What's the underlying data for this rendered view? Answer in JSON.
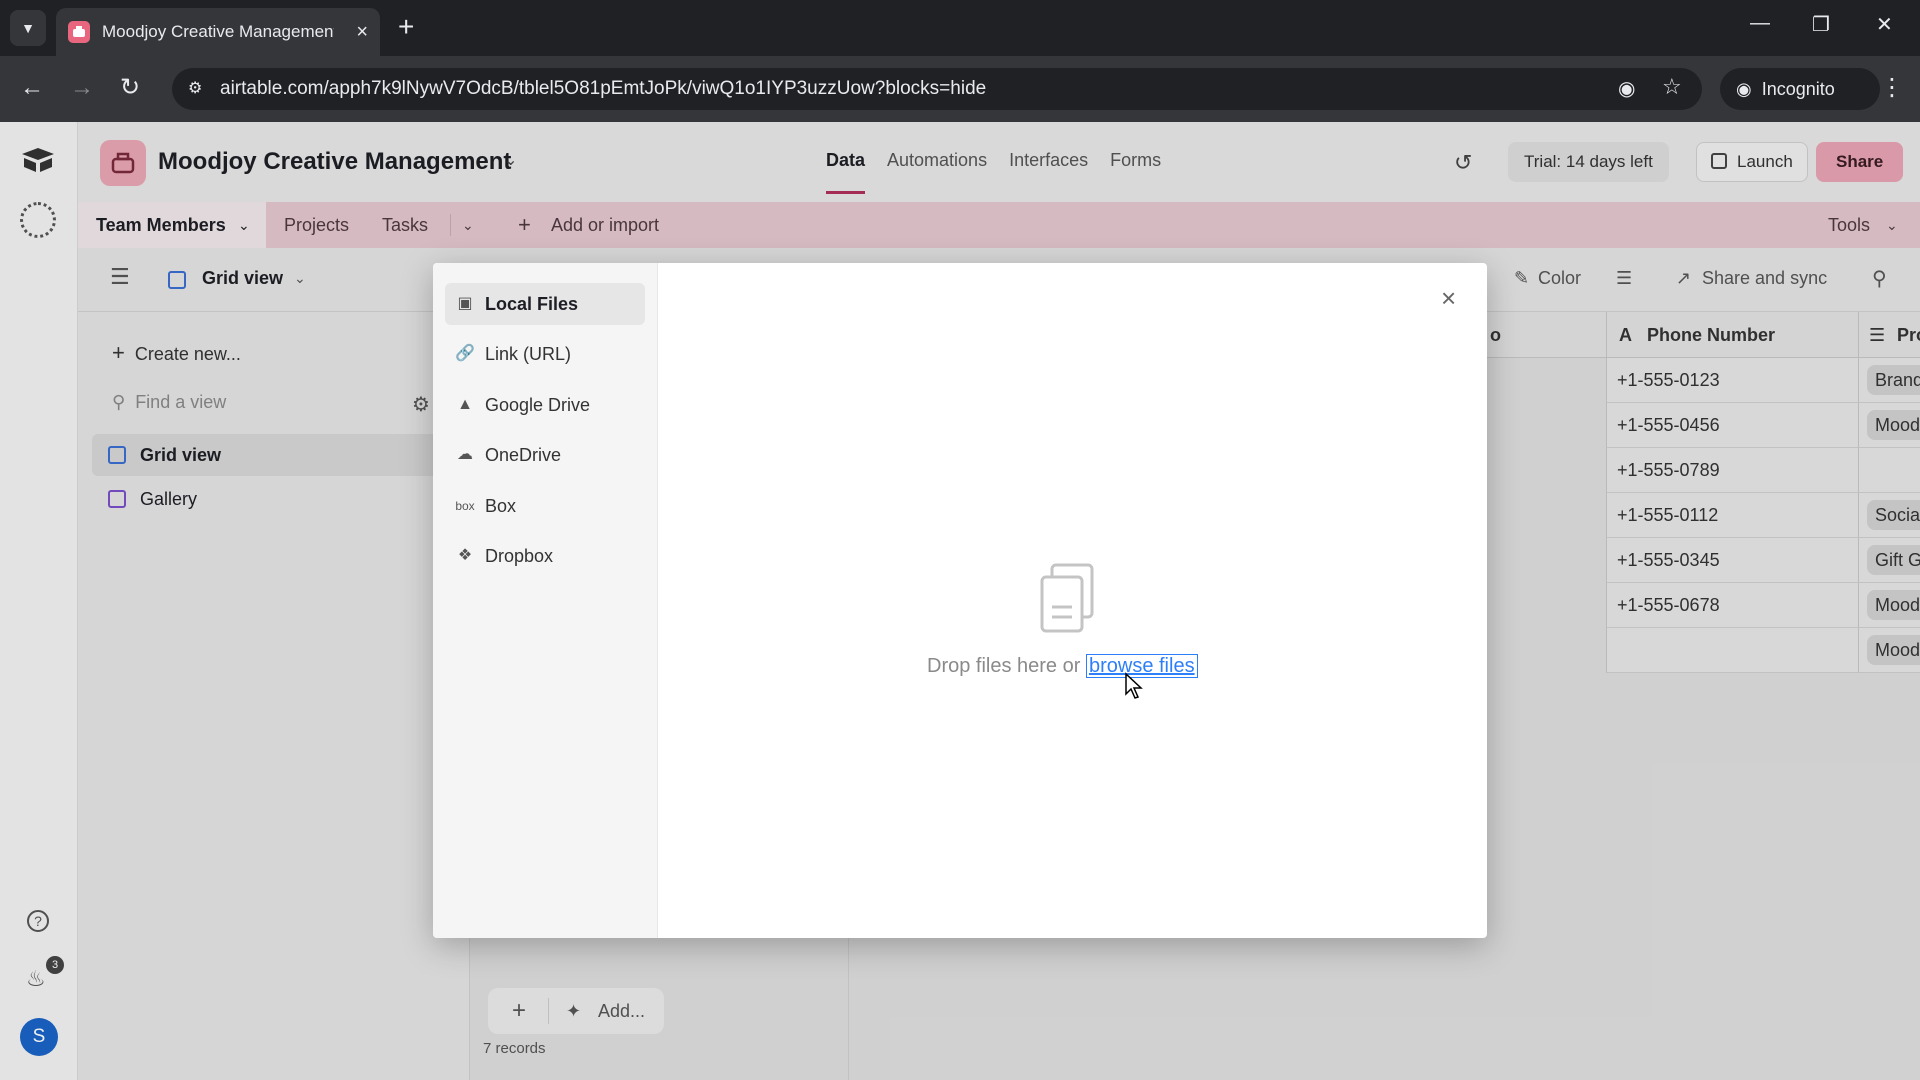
{
  "browser": {
    "tab_title": "Moodjoy Creative Management",
    "url": "airtable.com/apph7k9lNywV7OdcB/tblel5O81pEmtJoPk/viwQ1o1IYP3uzzUow?blocks=hide",
    "incognito_label": "Incognito",
    "brand_color": "#e8677f"
  },
  "header": {
    "base_name": "Moodjoy Creative Management",
    "nav": [
      "Data",
      "Automations",
      "Interfaces",
      "Forms"
    ],
    "trial": "Trial: 14 days left",
    "launch": "Launch",
    "share": "Share",
    "accent": "#b0305b"
  },
  "tables": {
    "active": "Team Members",
    "items": [
      "Projects",
      "Tasks"
    ],
    "add": "Add or import",
    "tools": "Tools"
  },
  "viewbar": {
    "view_name": "Grid view",
    "color": "Color",
    "share_sync": "Share and sync"
  },
  "views": {
    "create": "Create new...",
    "find_placeholder": "Find a view",
    "items": [
      "Grid view",
      "Gallery"
    ]
  },
  "grid": {
    "col_prev": "o",
    "col_phone": "Phone Number",
    "col_next": "Pro",
    "phones": [
      "+1-555-0123",
      "+1-555-0456",
      "+1-555-0789",
      "+1-555-0112",
      "+1-555-0345",
      "+1-555-0678",
      ""
    ],
    "tags": [
      "Brand",
      "Mood",
      "",
      "Social",
      "Gift G",
      "Mood",
      "Mood"
    ],
    "add_label": "Add...",
    "records": "7 records"
  },
  "rail": {
    "notification_count": "3",
    "avatar_initial": "S"
  },
  "modal": {
    "sources": [
      "Local Files",
      "Link (URL)",
      "Google Drive",
      "OneDrive",
      "Box",
      "Dropbox"
    ],
    "selected_source": "Local Files",
    "drop_text": "Drop files here or",
    "browse_text": "browse files",
    "link_color": "#2d7ff9"
  }
}
